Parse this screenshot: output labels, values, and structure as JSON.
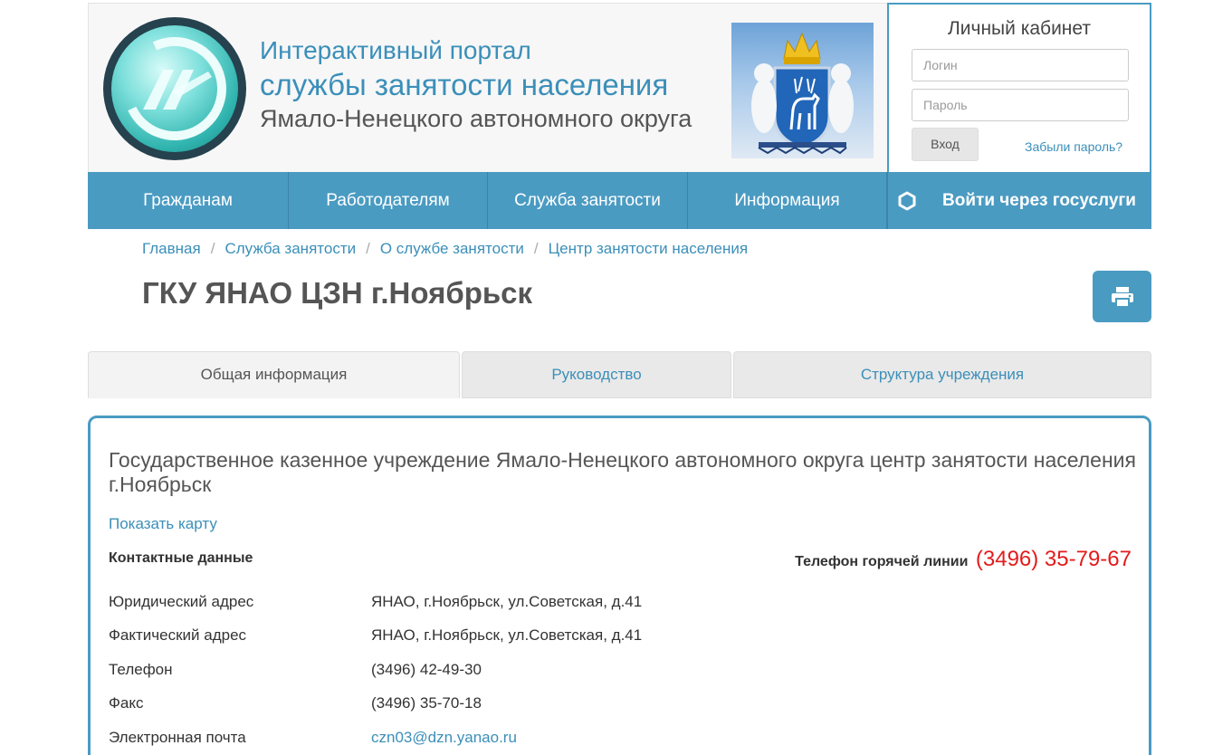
{
  "header": {
    "title_line1": "Интерактивный портал",
    "title_line2": "службы занятости населения",
    "title_line3": "Ямало-Ненецкого автономного округа"
  },
  "login": {
    "title": "Личный кабинет",
    "login_placeholder": "Логин",
    "password_placeholder": "Пароль",
    "enter_label": "Вход",
    "forgot_label": "Забыли пароль?"
  },
  "nav": {
    "items": [
      {
        "label": "Гражданам"
      },
      {
        "label": "Работодателям"
      },
      {
        "label": "Служба занятости"
      },
      {
        "label": "Информация"
      }
    ],
    "gosuslugi_label": "Войти через госуслуги"
  },
  "breadcrumb": [
    {
      "label": "Главная"
    },
    {
      "label": "Служба занятости"
    },
    {
      "label": "О службе занятости"
    },
    {
      "label": "Центр занятости населения"
    }
  ],
  "page_title": "ГКУ ЯНАО ЦЗН г.Ноябрьск",
  "tabs": [
    {
      "label": "Общая информация",
      "active": true
    },
    {
      "label": "Руководство",
      "active": false
    },
    {
      "label": "Структура учреждения",
      "active": false
    }
  ],
  "card": {
    "org_name": "Государственное казенное учреждение Ямало-Ненецкого автономного округа центр занятости населения г.Ноябрьск",
    "map_link": "Показать карту",
    "contacts_heading": "Контактные данные",
    "hotline_label": "Телефон горячей линии",
    "hotline_number": "(3496) 35-79-67",
    "rows": [
      {
        "key": "Юридический адрес",
        "value": "ЯНАО, г.Ноябрьск, ул.Советская, д.41"
      },
      {
        "key": "Фактический адрес",
        "value": "ЯНАО, г.Ноябрьск, ул.Советская, д.41"
      },
      {
        "key": "Телефон",
        "value": "(3496) 42-49-30"
      },
      {
        "key": "Факс",
        "value": "(3496) 35-70-18"
      },
      {
        "key": "Электронная почта",
        "value": "czn03@dzn.yanao.ru"
      }
    ]
  },
  "colors": {
    "primary": "#4a9bc2",
    "link": "#3b8fb9",
    "hotline": "#e41b1b"
  },
  "icons": {
    "print": "printer-icon",
    "gosuslugi": "gosuslugi-hexagon-icon"
  }
}
